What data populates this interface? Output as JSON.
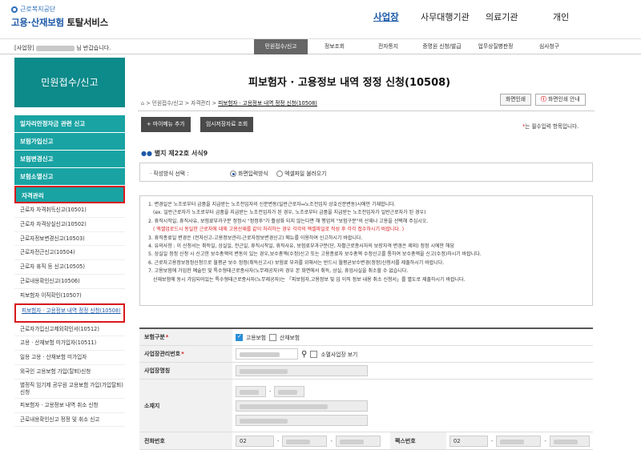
{
  "header": {
    "logo_sub": "근로복지공단",
    "logo_main_blue": "고용·산재보험",
    "logo_main_black": "토탈서비스",
    "nav": [
      "사업장",
      "사무대행기관",
      "의료기관",
      "개인"
    ]
  },
  "subbar": {
    "welcome_prefix": "[사업장]",
    "welcome_suffix": "님 반갑습니다.",
    "tabs": [
      "민원접수/신고",
      "정보조회",
      "전자통지",
      "증명원 신청/발급",
      "업무상질병판정",
      "심사청구"
    ]
  },
  "sidebar": {
    "title": "민원접수/신고",
    "categories": [
      "일자리안정자금 관련 신고",
      "보험가입신고",
      "보험변경신고",
      "보험소멸신고",
      "자격관리"
    ],
    "items": [
      "근로자 자격취득신고(10501)",
      "근로자 자격상실신고(10502)",
      "근로자정보변경신고(10503)",
      "근로자전근신고(10504)",
      "근로자 휴직 등 신고(10505)",
      "근로내용확인신고(10506)",
      "피보험자 이직확인(10507)",
      "피보험자 · 고용정보 내역 정정 신청(10508)",
      "근로자가입신고제외확인서(10512)",
      "고용 · 산재보험 미가입자(10511)",
      "일용 고용 · 산재보험 미가입자",
      "외국인 고용보험 가입(탈퇴)신청",
      "별정직 임기제 공무원 고용보험 가입(가입탈퇴)신청",
      "피보험자 · 고용정보 내역 취소 신청",
      "근로내용확인신고 정정 및 취소 신고"
    ]
  },
  "main": {
    "title": "피보험자 · 고용정보 내역 정정 신청(10508)",
    "breadcrumb": [
      "민원접수/신고",
      "자격관리",
      "피보험자 · 고용정보 내역 정정 신청(10508)"
    ],
    "print_button": "화면인쇄",
    "print_guide_button": "화면인쇄 안내",
    "add_menu_button": "+ 마이메뉴 추가",
    "temp_load_button": "임시저장자료 조회",
    "required_note_star": "*",
    "required_note": "는 필수입력 항목입니다.",
    "form_no": "별지 제22호 서식9",
    "method_label": "· 작성방식 선택 :",
    "method_options": [
      "화면입력방식",
      "엑셀파일 불러오기"
    ],
    "notes": [
      "1. 변경일은 노조로부터 금품을 지급받는 노조전임자의 신분변동(일반근로자↔노조전임자 상호신분변동)시에만 기재합니다.",
      "(ex. 일반근로자가 노조로부터 금품을 지급받는 노조전임자가 된 경우, 노조로부터 금품을 지급받는 노조전임자가 일반근로자가 된 경우)",
      "2. 휴직시작일, 휴직사유, 보험료부과구분 정정시 \"정정후\"가 활성화 되지 않는다면 해 행업의 \"보험구분\"의 산재나 고용을 선택해 주십시오.",
      "( 엑셀업로드시 동일한 근로자에 대해 고용산재를 같이 처리하는 경우 각각의 엑셀파일로 작성 후 각각 접수하시기 바랍니다. )",
      "3. 휴직종료일 변경은 (전자신고-고용정보관리-근로자정보변경신고) 메뉴를 이용하여 신고하시기 바랍니다.",
      "4. 유의사항 : 이 신청서는 취득일, 상실일, 전근일, 휴직시작일, 휴직사유, 보험료부과구분(단, 자활근로종사자의 보장자격 변경은 제외) 정정 시에만 해당",
      "5. 상실일 정정 신청 시 신고한 보수총액의 변동이 있는 경우,보수총액(수정)신고 또는 고용종료자 보수총액 수정신고를 통하여 보수총액을 신고(수정)하시기 바랍니다.",
      "6. 근로자고용정보정정신청으로 월평균 보수 정정(취득신고시) 보험료 부과를 위해서는 반드시 월평균보수변경(정정)신청서를 제출하시기 바랍니다.",
      "7. 고용보험에 가입한 예술인 및 특수형태근로종사자(노무제공자)의 경우 본 화면에서 취득, 상실, 휴업사실을 취소할 수 없습니다.",
      "산재보험에 동시 가입되어있는 특수형태근로종사자(노무제공자)는 「피보험자,고용정보 및 입 이직 정보 내용 취소 신청서」를 별도로 제출하시기 바랍니다."
    ],
    "form": {
      "insurance_label": "보험구분",
      "insurance_options": [
        "고용보험",
        "산재보험"
      ],
      "workplace_no_label": "사업장관리번호",
      "small_workplace": "소멸사업장 보기",
      "workplace_name_label": "사업장명칭",
      "address_label": "소재지",
      "phone_label": "전화번호",
      "phone_prefix": "02",
      "fax_label": "팩스번호",
      "fax_prefix": "02"
    }
  },
  "colors": {
    "sidebar_head": "#0d8a8a",
    "sidebar_category": "#1aa3a3",
    "highlight_red": "#d9191c",
    "brand_blue": "#1e5aa8"
  }
}
